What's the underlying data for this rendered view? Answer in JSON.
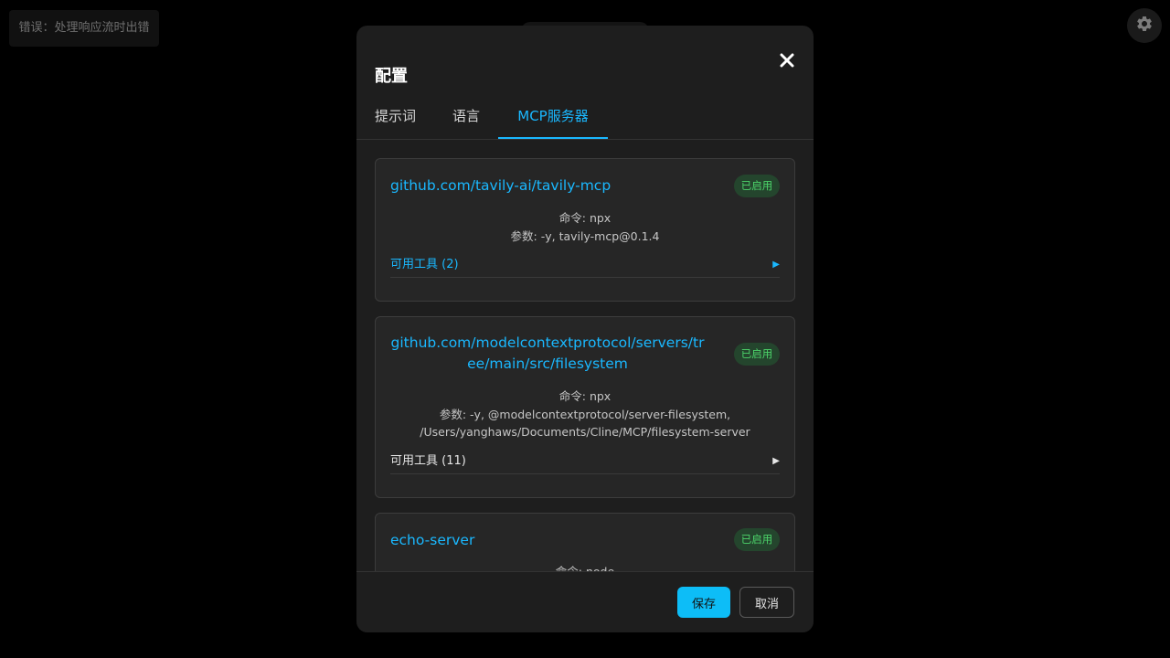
{
  "error": {
    "text": "错误：处理响应流时出错"
  },
  "modal": {
    "title": "配置",
    "tabs": [
      {
        "label": "提示词",
        "active": false
      },
      {
        "label": "语言",
        "active": false
      },
      {
        "label": "MCP服务器",
        "active": true
      }
    ],
    "servers": [
      {
        "name": "github.com/tavily-ai/tavily-mcp",
        "status": "已启用",
        "command": "命令: npx",
        "args": "参数: -y, tavily-mcp@0.1.4",
        "tools": "可用工具 (2)",
        "tools_arrow": "▶"
      },
      {
        "name": "github.com/modelcontextprotocol/servers/tree/main/src/filesystem",
        "status": "已启用",
        "command": "命令: npx",
        "args": "参数: -y, @modelcontextprotocol/server-filesystem, /Users/yanghaws/Documents/Cline/MCP/filesystem-server",
        "tools": "可用工具 (11)",
        "tools_arrow": "▶"
      },
      {
        "name": "echo-server",
        "status": "已启用",
        "command": "命令: node"
      }
    ],
    "save_label": "保存",
    "cancel_label": "取消"
  },
  "colors": {
    "accent": "#1ab8ff",
    "enabled_badge_bg": "#24452d",
    "enabled_badge_text": "#4cd46a",
    "modal_bg": "#1e1e1e",
    "card_bg": "#262626"
  },
  "icons": {
    "close": "close-icon",
    "settings": "gear-icon",
    "expand": "play-arrow-icon"
  }
}
